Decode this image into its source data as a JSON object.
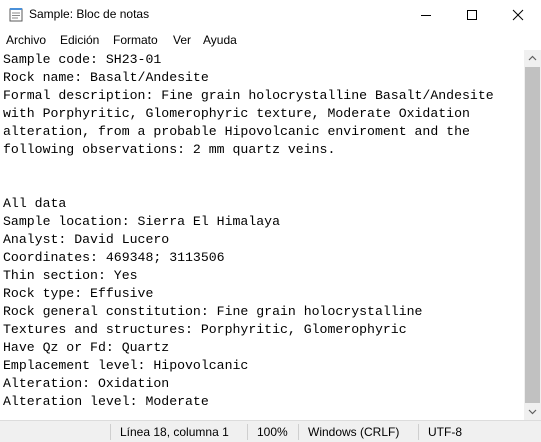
{
  "window": {
    "title": "Sample: Bloc de notas",
    "minimize_icon": "minimize-icon",
    "maximize_icon": "maximize-icon",
    "close_icon": "close-icon"
  },
  "menu": [
    "Archivo",
    "Edición",
    "Formato",
    "Ver",
    "Ayuda"
  ],
  "document": {
    "lines": [
      "Sample code: SH23-01",
      "Rock name: Basalt/Andesite",
      "Formal description: Fine grain holocrystalline Basalt/Andesite",
      "with Porphyritic, Glomerophyric texture, Moderate Oxidation",
      "alteration, from a probable Hipovolcanic enviroment and the",
      "following observations: 2 mm quartz veins.",
      "",
      "",
      "All data",
      "Sample location: Sierra El Himalaya",
      "Analyst: David Lucero",
      "Coordinates: 469348; 3113506",
      "Thin section: Yes",
      "Rock type: Effusive",
      "Rock general constitution: Fine grain holocrystalline",
      "Textures and structures: Porphyritic, Glomerophyric",
      "Have Qz or Fd: Quartz",
      "Emplacement level: Hipovolcanic",
      "Alteration: Oxidation",
      "Alteration level: Moderate"
    ]
  },
  "status": {
    "position": "Línea 18, columna 1",
    "zoom": "100%",
    "line_ending": "Windows (CRLF)",
    "encoding": "UTF-8"
  }
}
